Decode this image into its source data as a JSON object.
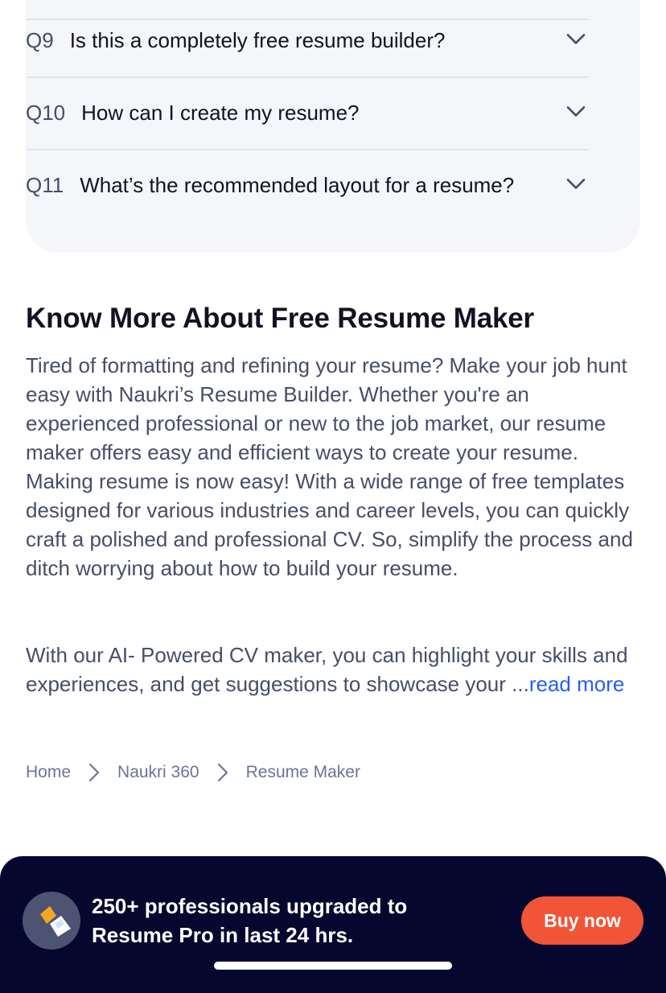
{
  "faq": {
    "items": [
      {
        "num": "Q9",
        "question": "Is this a completely free resume builder?"
      },
      {
        "num": "Q10",
        "question": "How can I create my resume?"
      },
      {
        "num": "Q11",
        "question": "What’s the recommended layout for a resume?"
      }
    ]
  },
  "about": {
    "title": "Know More About Free Resume Maker",
    "paragraph1": "Tired of formatting and refining your resume? Make your job hunt easy with Naukri’s Resume Builder. Whether you're an experienced professional or new to the job market, our resume maker offers easy and efficient ways to create your resume. Making resume is now easy! With a wide range of free templates designed for various industries and career levels, you can quickly craft a polished and professional CV. So, simplify the process and ditch worrying about how to build your resume.",
    "paragraph2": "With our AI- Powered CV maker, you can highlight your skills and experiences, and get suggestions to showcase your ...",
    "read_more": "read more"
  },
  "breadcrumb": {
    "items": [
      "Home",
      "Naukri 360",
      "Resume Maker"
    ]
  },
  "promo": {
    "text_line1": "250+ professionals upgraded to",
    "text_line2": "Resume Pro in last 24 hrs.",
    "button_label": "Buy now"
  },
  "colors": {
    "accent_orange": "#f05537",
    "link_blue": "#275df5",
    "promo_bg": "#05072f"
  }
}
